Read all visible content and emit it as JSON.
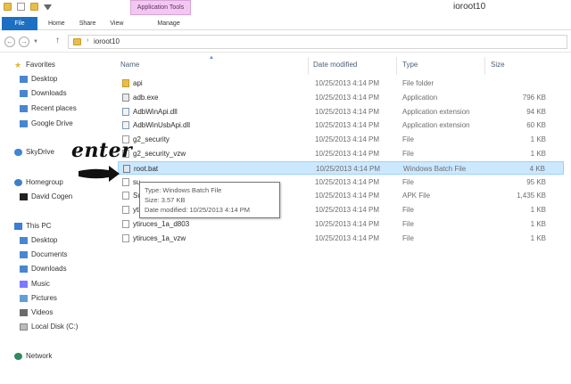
{
  "window": {
    "title": "ioroot10"
  },
  "ribbon": {
    "context_tab": "Application Tools",
    "tabs": [
      "File",
      "Home",
      "Share",
      "View",
      "Manage"
    ]
  },
  "address_bar": {
    "path": "ioroot10",
    "separator": "›"
  },
  "nav_pane": {
    "favorites": {
      "label": "Favorites",
      "items": [
        "Desktop",
        "Downloads",
        "Recent places",
        "Google Drive"
      ]
    },
    "skydrive": "SkyDrive",
    "homegroup": {
      "label": "Homegroup",
      "items": [
        "David Cogen"
      ]
    },
    "this_pc": {
      "label": "This PC",
      "items": [
        "Desktop",
        "Documents",
        "Downloads",
        "Music",
        "Pictures",
        "Videos",
        "Local Disk (C:)"
      ]
    },
    "network": "Network"
  },
  "columns": {
    "name": "Name",
    "date": "Date modified",
    "type": "Type",
    "size": "Size"
  },
  "files": [
    {
      "name": "api",
      "date": "10/25/2013 4:14 PM",
      "type": "File folder",
      "size": "",
      "icon": "folder-icon"
    },
    {
      "name": "adb.exe",
      "date": "10/25/2013 4:14 PM",
      "type": "Application",
      "size": "796 KB",
      "icon": "exe-icon"
    },
    {
      "name": "AdbWinApi.dll",
      "date": "10/25/2013 4:14 PM",
      "type": "Application extension",
      "size": "94 KB",
      "icon": "dll-icon"
    },
    {
      "name": "AdbWinUsbApi.dll",
      "date": "10/25/2013 4:14 PM",
      "type": "Application extension",
      "size": "60 KB",
      "icon": "dll-icon"
    },
    {
      "name": "g2_security",
      "date": "10/25/2013 4:14 PM",
      "type": "File",
      "size": "1 KB",
      "icon": "file-icon"
    },
    {
      "name": "g2_security_vzw",
      "date": "10/25/2013 4:14 PM",
      "type": "File",
      "size": "1 KB",
      "icon": "file-icon"
    },
    {
      "name": "root.bat",
      "date": "10/25/2013 4:14 PM",
      "type": "Windows Batch File",
      "size": "4 KB",
      "icon": "bat-icon"
    },
    {
      "name": "su",
      "date": "10/25/2013 4:14 PM",
      "type": "File",
      "size": "95 KB",
      "icon": "file-icon"
    },
    {
      "name": "Su",
      "date": "10/25/2013 4:14 PM",
      "type": "APK File",
      "size": "1,435 KB",
      "icon": "apk-icon"
    },
    {
      "name": "yti",
      "date": "10/25/2013 4:14 PM",
      "type": "File",
      "size": "1 KB",
      "icon": "file-icon"
    },
    {
      "name": "ytiruces_1a_d803",
      "date": "10/25/2013 4:14 PM",
      "type": "File",
      "size": "1 KB",
      "icon": "file-icon"
    },
    {
      "name": "ytiruces_1a_vzw",
      "date": "10/25/2013 4:14 PM",
      "type": "File",
      "size": "1 KB",
      "icon": "file-icon"
    }
  ],
  "tooltip": {
    "type_line": "Type: Windows Batch File",
    "size_line": "Size: 3.57 KB",
    "date_line": "Date modified: 10/25/2013 4:14 PM"
  },
  "annotation": {
    "text": "enter"
  },
  "colors": {
    "file_tab": "#1d6fc1",
    "context_tab": "#f1c8f0",
    "selection": "#cce8ff",
    "selection_border": "#99d1ff"
  }
}
